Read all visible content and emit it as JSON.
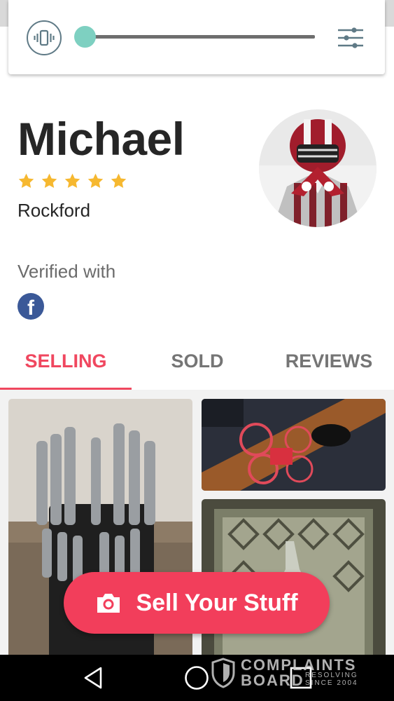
{
  "profile": {
    "name": "Michael",
    "rating": 5,
    "location": "Rockford",
    "verified_label": "Verified with",
    "verified_provider": "f"
  },
  "tabs": [
    {
      "label": "SELLING",
      "active": true
    },
    {
      "label": "SOLD",
      "active": false
    },
    {
      "label": "REVIEWS",
      "active": false
    }
  ],
  "volume": {
    "level": 0,
    "icons": [
      "vibrate-icon",
      "sliders-icon"
    ]
  },
  "sell_button": {
    "label": "Sell Your Stuff",
    "icon": "camera-icon"
  },
  "nav": [
    "back-icon",
    "home-icon",
    "recents-icon"
  ],
  "watermark": {
    "line1": "COMPLAINTS",
    "line2": "BOARD",
    "side1": "RESOLVING",
    "side2": "SINCE 2004"
  },
  "colors": {
    "accent": "#f0475f",
    "star": "#f6b830",
    "facebook": "#3b5998",
    "slider_thumb": "#7ed0c1"
  }
}
